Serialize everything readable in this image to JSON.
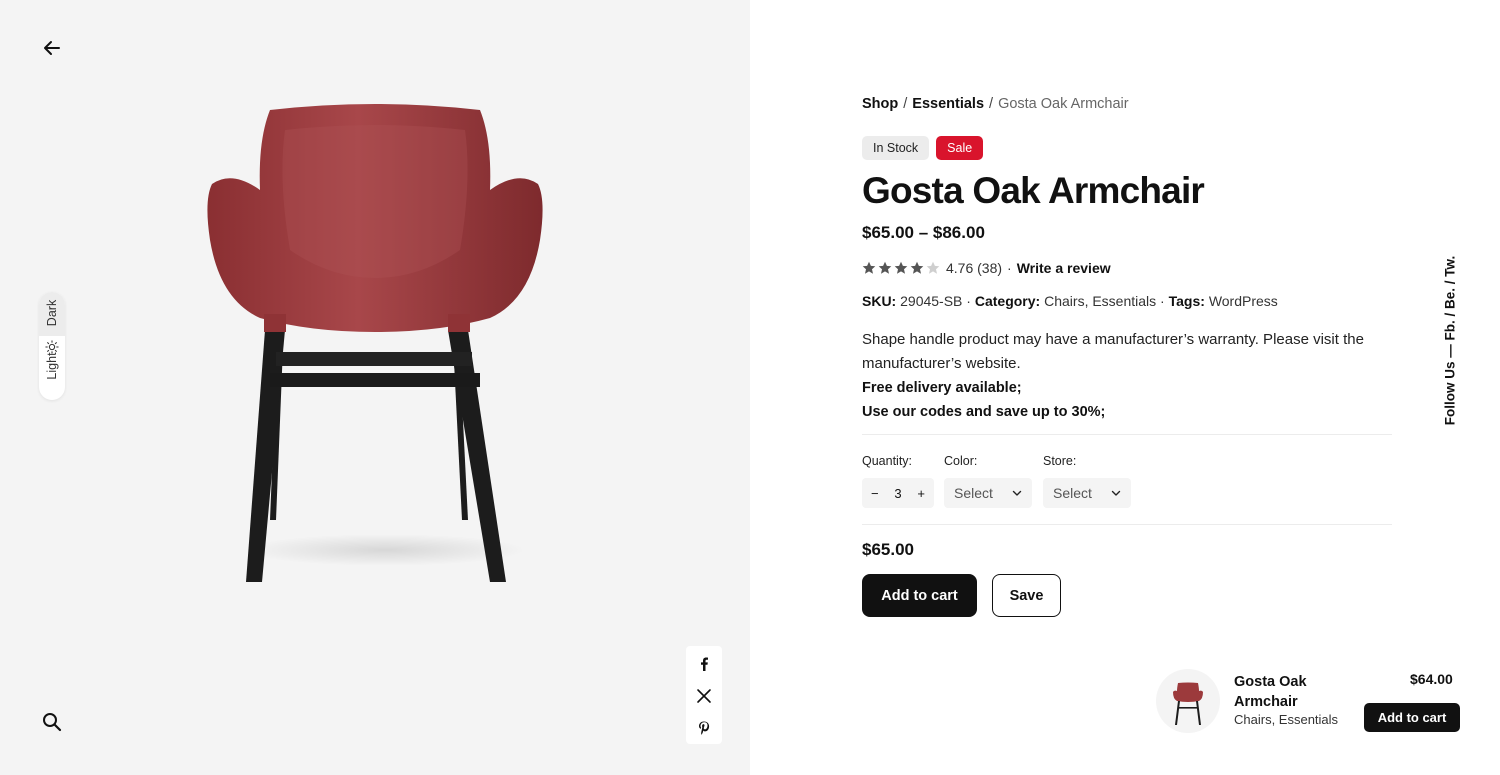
{
  "nav": {
    "back_icon": "arrow-left-icon",
    "search_icon": "search-icon"
  },
  "theme": {
    "dark_label": "Dark",
    "light_label": "Light",
    "sun_icon": "sun-icon"
  },
  "breadcrumb": {
    "items": [
      "Shop",
      "Essentials",
      "Gosta Oak Armchair"
    ],
    "separator": "/"
  },
  "badges": {
    "stock": "In Stock",
    "sale": "Sale",
    "sale_color": "#d9142c"
  },
  "product": {
    "title": "Gosta Oak Armchair",
    "price_range": "$65.00 – $86.00",
    "rating": 4.76,
    "rating_text": "4.76 (38)",
    "stars_filled": 4,
    "stars_total": 5,
    "dot": "·",
    "write_review": "Write a review",
    "sku_label": "SKU:",
    "sku_value": "29045-SB",
    "category_label": "Category:",
    "category_value": "Chairs, Essentials",
    "tags_label": "Tags:",
    "tags_value": "WordPress",
    "description": "Shape handle product may have a manufacturer’s warranty. Please visit the manufacturer’s website.",
    "delivery": "Free delivery available;",
    "codes": "Use our codes and save up to 30%;"
  },
  "options": {
    "quantity_label": "Quantity:",
    "quantity_value": "3",
    "minus": "−",
    "plus": "+",
    "color_label": "Color:",
    "color_value": "Select",
    "store_label": "Store:",
    "store_value": "Select"
  },
  "purchase": {
    "current_price": "$65.00",
    "add_to_cart": "Add to cart",
    "save": "Save"
  },
  "share": {
    "icons": [
      "facebook-icon",
      "x-twitter-icon",
      "pinterest-icon"
    ]
  },
  "follow": {
    "text": "Follow Us — Fb. / Be. / Tw."
  },
  "sticky_cart": {
    "title": "Gosta Oak Armchair",
    "categories": "Chairs, Essentials",
    "price": "$64.00",
    "button": "Add to cart"
  },
  "colors": {
    "chair_shell": "#9c3a3c",
    "chair_legs": "#1c1c1c",
    "gallery_bg": "#f4f4f4",
    "primary": "#111111"
  }
}
